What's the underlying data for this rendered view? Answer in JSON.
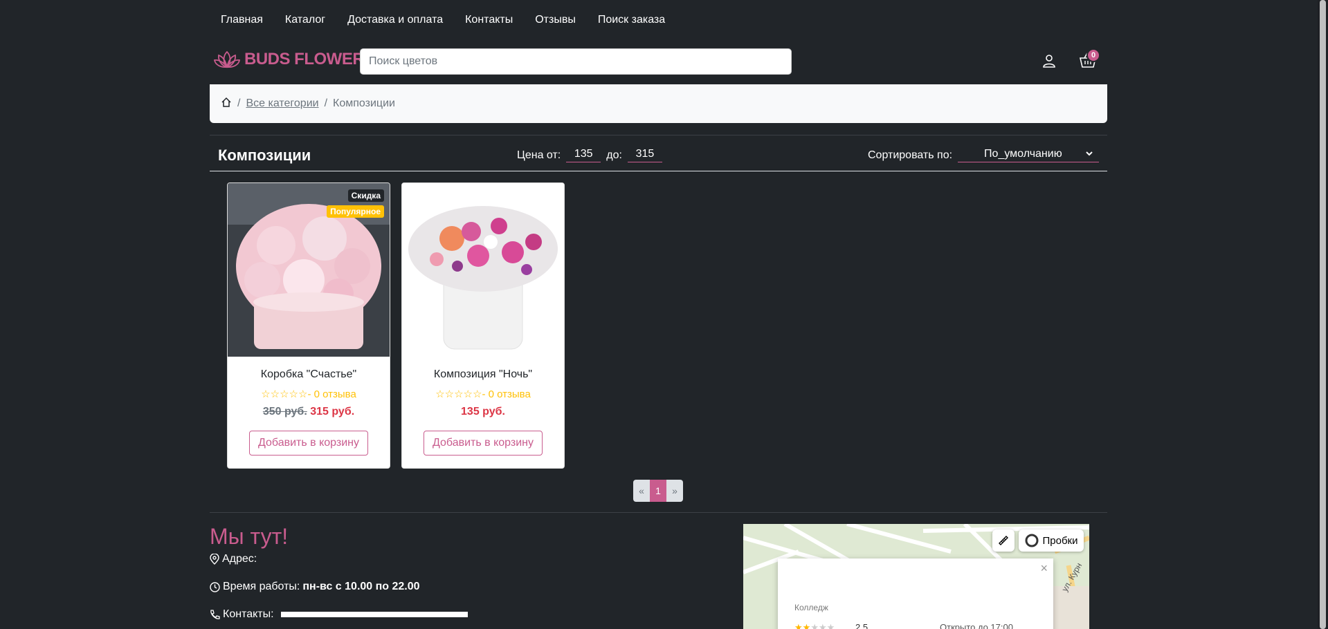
{
  "nav": {
    "items": [
      "Главная",
      "Каталог",
      "Доставка и оплата",
      "Контакты",
      "Отзывы",
      "Поиск заказа"
    ]
  },
  "header": {
    "logo_text": "BUDS FLOWERS",
    "search_placeholder": "Поиск цветов",
    "cart_count": "0"
  },
  "breadcrumb": {
    "all_categories": "Все категории",
    "separator": "/",
    "current": "Композиции"
  },
  "toolbar": {
    "title": "Композиции",
    "price_from_label": "Цена от:",
    "price_from": "135",
    "price_to_label": "до:",
    "price_to": "315",
    "sort_label": "Сортировать по:",
    "sort_value": "По_умолчанию"
  },
  "products": [
    {
      "name": "Коробка \"Счастье\"",
      "badge_sale": "Скидка",
      "badge_popular": "Популярное",
      "stars": "☆☆☆☆☆",
      "reviews": "- 0 отзыва",
      "old_price": "350 руб.",
      "price": "315 руб.",
      "button": "Добавить в корзину"
    },
    {
      "name": "Композиция \"Ночь\"",
      "stars": "☆☆☆☆☆",
      "reviews": "- 0 отзыва",
      "price": "135 руб.",
      "button": "Добавить в корзину"
    }
  ],
  "pagination": {
    "prev": "«",
    "current": "1",
    "next": "»"
  },
  "location": {
    "title": "Мы тут!",
    "address_label": "Адрес:",
    "hours_label": "Время работы:",
    "hours_value": "пн-вс с 10.00 по 22.00",
    "contacts_label": "Контакты:"
  },
  "map": {
    "traffic_button": "Пробки",
    "place_name": "Колледж",
    "rating": "2,5",
    "open_status": "Открыто до 17:00",
    "street": "ул. Курн"
  },
  "colors": {
    "accent": "#c95c8e",
    "background": "#212529",
    "badge_popular": "#ffc107",
    "price": "#dc3545"
  }
}
